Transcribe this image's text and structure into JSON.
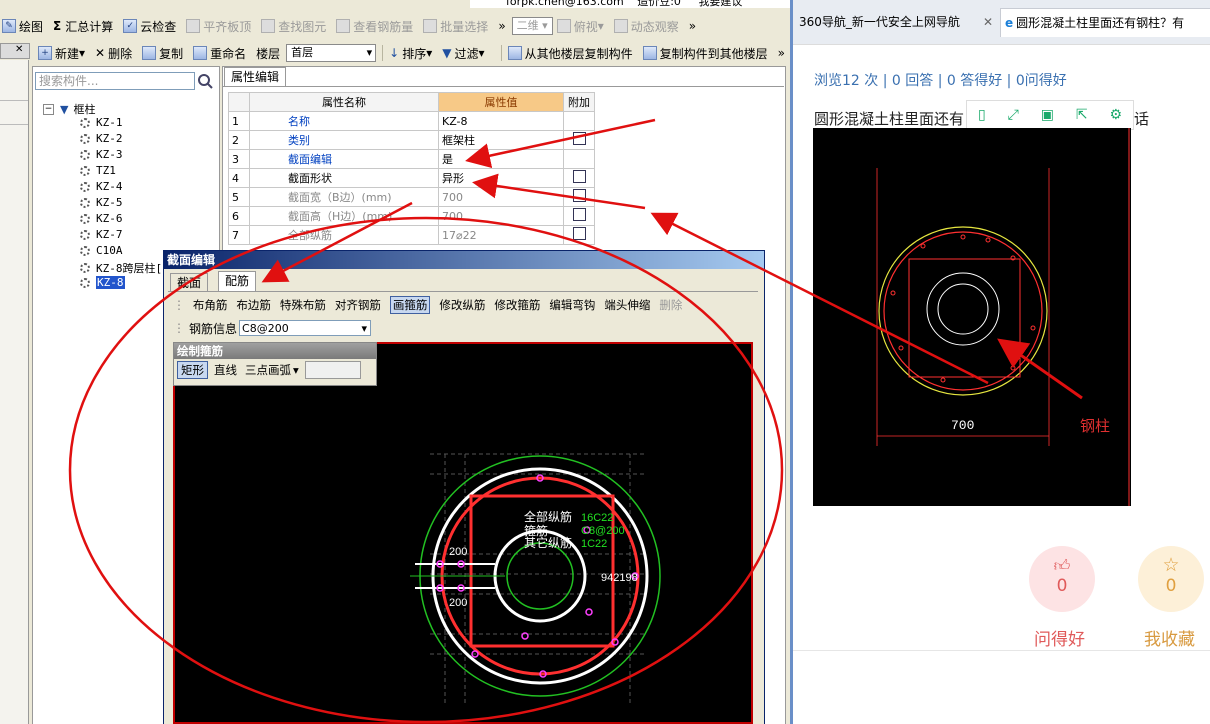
{
  "app": {
    "top_strip": {
      "email": "forpk.chen@163.com",
      "beans": "造价豆:0",
      "suggest": "我要建议"
    },
    "toolbar1": [
      "绘图",
      "汇总计算",
      "云检查",
      "平齐板顶",
      "查找图元",
      "查看钢筋量",
      "批量选择",
      "二维",
      "俯视",
      "动态观察"
    ],
    "toolbar2": {
      "new": "新建",
      "delete": "删除",
      "copy": "复制",
      "rename": "重命名",
      "floor_label": "楼层",
      "floor_value": "首层",
      "sort": "排序",
      "filter": "过滤",
      "copy_from": "从其他楼层复制构件",
      "copy_to": "复制构件到其他楼层"
    },
    "search_placeholder": "搜索构件...",
    "tree": {
      "root": "框柱",
      "items": [
        "KZ-1",
        "KZ-2",
        "KZ-3",
        "TZ1",
        "KZ-4",
        "KZ-5",
        "KZ-6",
        "KZ-7",
        "C10A",
        "KZ-8跨层柱[",
        "KZ-8"
      ]
    },
    "props_tab": "属性编辑",
    "props": {
      "headers": [
        "属性名称",
        "属性值",
        "附加"
      ],
      "rows": [
        {
          "n": "1",
          "name": "名称",
          "value": "KZ-8"
        },
        {
          "n": "2",
          "name": "类别",
          "value": "框架柱"
        },
        {
          "n": "3",
          "name": "截面编辑",
          "value": "是"
        },
        {
          "n": "4",
          "name": "截面形状",
          "value": "异形"
        },
        {
          "n": "5",
          "name": "截面宽（B边）(mm)",
          "value": "700"
        },
        {
          "n": "6",
          "name": "截面高（H边）(mm)",
          "value": "700"
        },
        {
          "n": "7",
          "name": "全部纵筋",
          "value": "17⌀22"
        }
      ]
    }
  },
  "dialog": {
    "title": "截面编辑",
    "tabs": [
      "截面",
      "配筋"
    ],
    "ribbon": [
      "布角筋",
      "布边筋",
      "特殊布筋",
      "对齐钢筋",
      "画箍筋",
      "修改纵筋",
      "修改箍筋",
      "编辑弯钩",
      "端头伸缩",
      "删除"
    ],
    "rebar_info_label": "钢筋信息",
    "rebar_info_value": "C8@200",
    "draw_panel_title": "绘制箍筋",
    "draw_modes": [
      "矩形",
      "直线",
      "三点画弧"
    ],
    "cad_labels": {
      "all_rebar": "全部纵筋",
      "all_rebar_val": "16C22",
      "stirrup": "箍筋",
      "stirrup_val": "C8@200",
      "other_rebar": "其它纵筋",
      "other_rebar_val": "1C22",
      "dim1": "200",
      "dim2": "200",
      "dim3": "942198"
    }
  },
  "browser": {
    "tabs": [
      "360导航_新一代安全上网导航",
      "圆形混凝土柱里面还有钢柱？有"
    ],
    "stats": "浏览12 次 | 0 回答 | 0 答得好 | 0问得好",
    "question_start": "圆形混凝土柱里面还有",
    "question_end": "？这样的话",
    "image_dim": "700",
    "annotation": "钢柱",
    "ask_good": {
      "count": "0",
      "label": "问得好"
    },
    "collect": {
      "count": "0",
      "label": "我收藏"
    }
  }
}
